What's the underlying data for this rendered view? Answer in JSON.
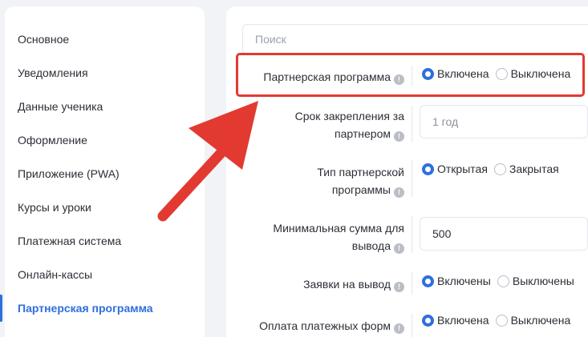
{
  "sidebar": {
    "items": [
      {
        "label": "Основное"
      },
      {
        "label": "Уведомления"
      },
      {
        "label": "Данные ученика"
      },
      {
        "label": "Оформление"
      },
      {
        "label": "Приложение (PWA)"
      },
      {
        "label": "Курсы и уроки"
      },
      {
        "label": "Платежная система"
      },
      {
        "label": "Онлайн-кассы"
      },
      {
        "label": "Партнерская программа",
        "active": true
      }
    ]
  },
  "search": {
    "placeholder": "Поиск"
  },
  "settings": {
    "partner_program": {
      "label": "Партнерская программа",
      "option_on": "Включена",
      "option_off": "Выключена",
      "selected": "on"
    },
    "binding_period": {
      "label_line1": "Срок закрепления за",
      "label_line2": "партнером",
      "value": "1 год"
    },
    "program_type": {
      "label_line1": "Тип партнерской",
      "label_line2": "программы",
      "option_open": "Открытая",
      "option_closed": "Закрытая",
      "selected": "open"
    },
    "min_withdraw": {
      "label_line1": "Минимальная сумма для",
      "label_line2": "вывода",
      "value": "500"
    },
    "withdraw_requests": {
      "label": "Заявки на вывод",
      "option_on": "Включены",
      "option_off": "Выключены",
      "selected": "on"
    },
    "form_payment": {
      "label": "Оплата платежных форм",
      "option_on": "Включена",
      "option_off": "Выключена",
      "selected": "on"
    }
  },
  "colors": {
    "accent": "#2e6fdc",
    "highlight": "#e23a31"
  },
  "icons": {
    "info": "info-icon"
  }
}
